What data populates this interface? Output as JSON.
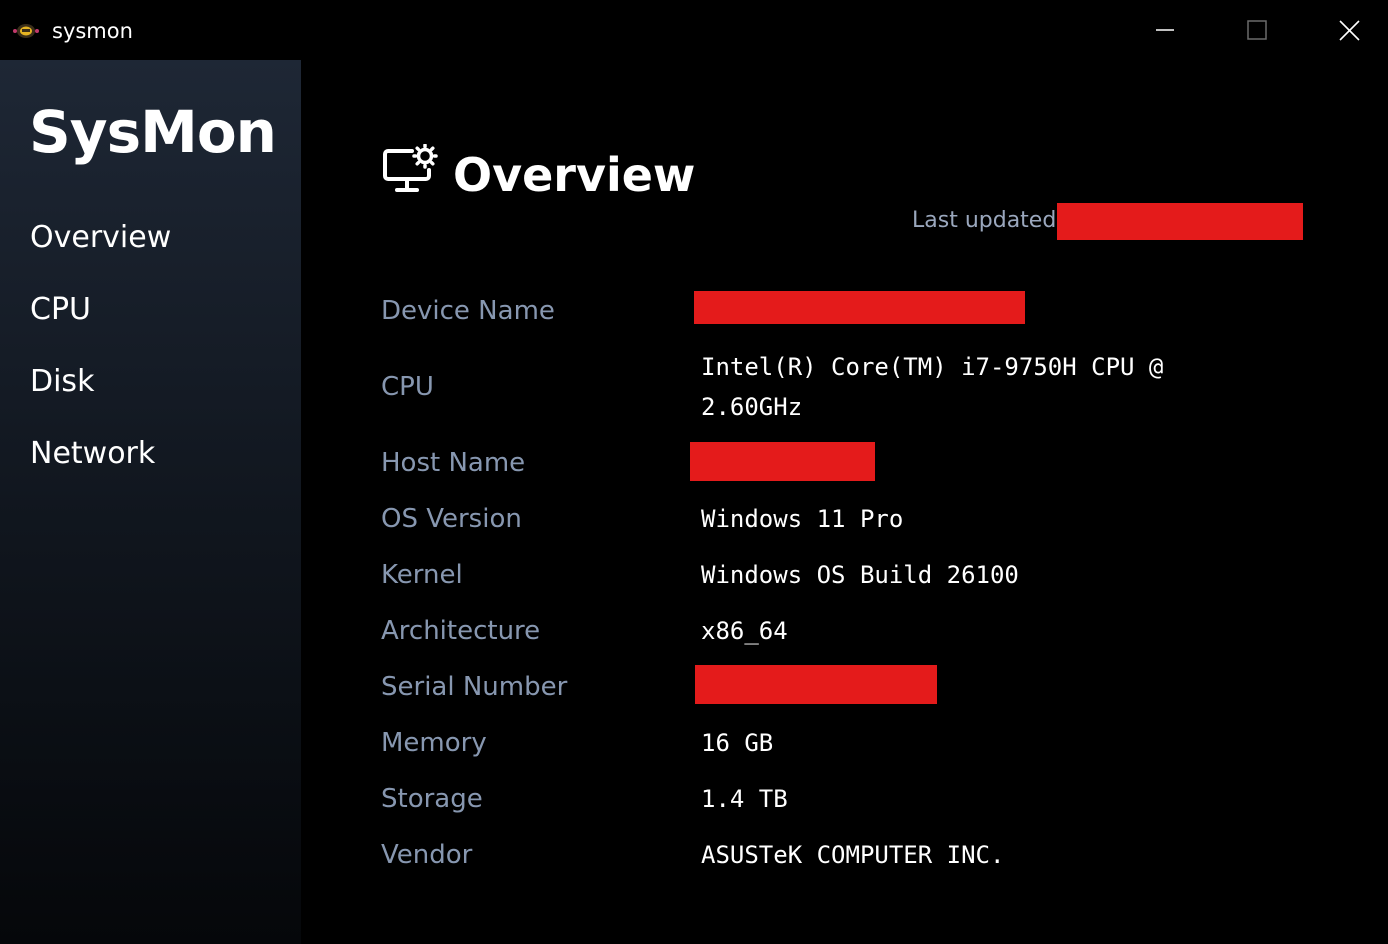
{
  "window": {
    "title": "sysmon",
    "controls": [
      "minimize-icon",
      "maximize-icon",
      "close-icon"
    ]
  },
  "sidebar": {
    "brand": "SysMon",
    "items": [
      {
        "label": "Overview"
      },
      {
        "label": "CPU"
      },
      {
        "label": "Disk"
      },
      {
        "label": "Network"
      }
    ]
  },
  "main": {
    "title": "Overview",
    "title_icon": "monitor-gear-icon",
    "last_updated_label": "Last updated:",
    "specs": [
      {
        "label": "Device Name",
        "value": ""
      },
      {
        "label": "CPU",
        "value": "Intel(R) Core(TM) i7-9750H CPU @ 2.60GHz"
      },
      {
        "label": "Host Name",
        "value": ""
      },
      {
        "label": "OS Version",
        "value": "Windows 11 Pro"
      },
      {
        "label": "Kernel",
        "value": "Windows OS Build 26100"
      },
      {
        "label": "Architecture",
        "value": "x86_64"
      },
      {
        "label": "Serial Number",
        "value": ""
      },
      {
        "label": "Memory",
        "value": "16 GB"
      },
      {
        "label": "Storage",
        "value": "1.4 TB"
      },
      {
        "label": "Vendor",
        "value": "ASUSTeK COMPUTER INC."
      }
    ]
  },
  "colors": {
    "background": "#000000",
    "sidebar_top": "#1e2735",
    "label": "#8797b0",
    "redaction": "#e41b1b"
  }
}
